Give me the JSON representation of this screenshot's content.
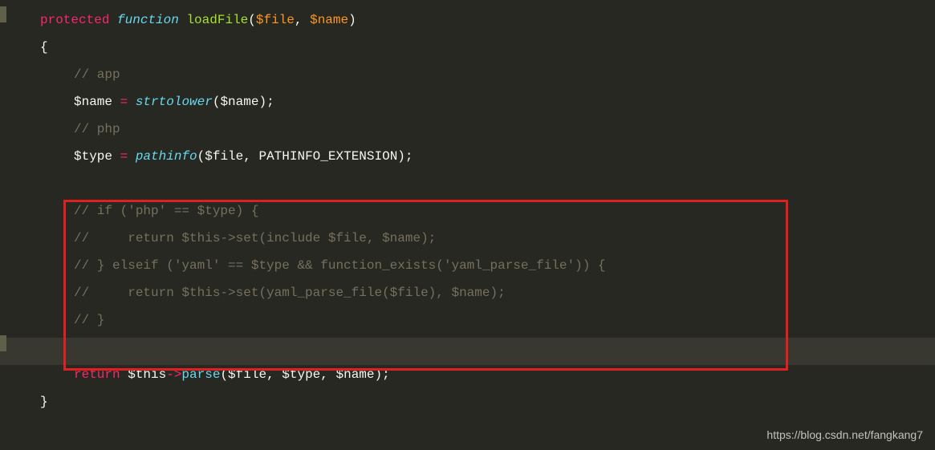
{
  "code": {
    "line1": {
      "protected": "protected",
      "function": "function",
      "fname": "loadFile",
      "open_paren": "(",
      "param1": "$file",
      "comma": ", ",
      "param2": "$name",
      "close_paren": ")"
    },
    "line2": "{",
    "line3": "// app",
    "line4": {
      "var": "$name",
      "assign": " = ",
      "fn": "strtolower",
      "open": "(",
      "arg": "$name",
      "close": ");"
    },
    "line5": "// php",
    "line6": {
      "var": "$type",
      "assign": " = ",
      "fn": "pathinfo",
      "open": "(",
      "arg1": "$file",
      "comma": ", ",
      "const": "PATHINFO_EXTENSION",
      "close": ");"
    },
    "line7": "",
    "line8": "// if ('php' == $type) {",
    "line9": "//     return $this->set(include $file, $name);",
    "line10": "// } elseif ('yaml' == $type && function_exists('yaml_parse_file')) {",
    "line11": "//     return $this->set(yaml_parse_file($file), $name);",
    "line12": "// }",
    "line13": "",
    "line14": {
      "return": "return",
      "this": " $this",
      "arrow": "->",
      "method": "parse",
      "open": "(",
      "arg1": "$file",
      "c1": ", ",
      "arg2": "$type",
      "c2": ", ",
      "arg3": "$name",
      "close": ");"
    },
    "line15": "}"
  },
  "watermark": "https://blog.csdn.net/fangkang7"
}
